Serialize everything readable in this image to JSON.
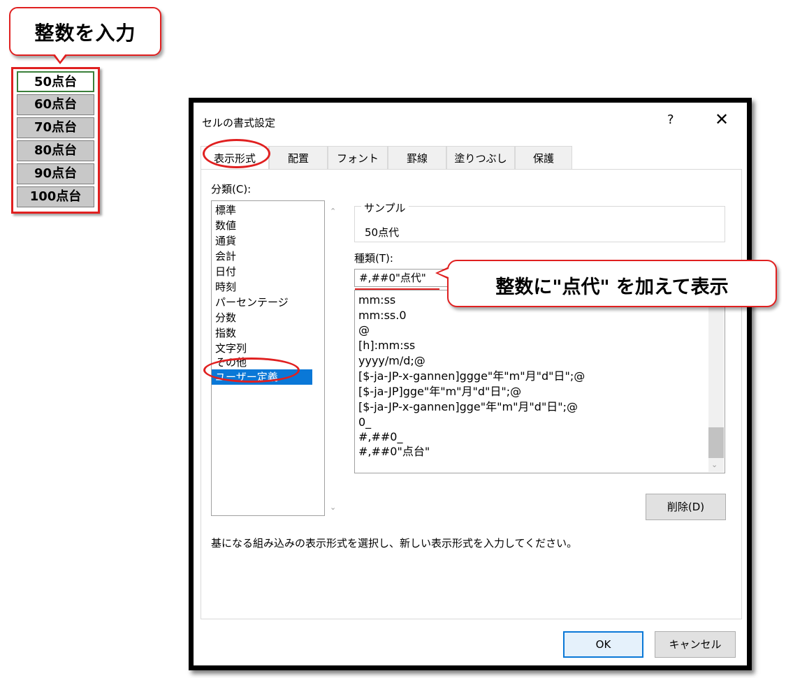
{
  "callouts": {
    "top": "整数を入力",
    "main": "整数に\"点代\" を加えて表示"
  },
  "cells": [
    "50点台",
    "60点台",
    "70点台",
    "80点台",
    "90点台",
    "100点台"
  ],
  "dialog": {
    "title": "セルの書式設定",
    "help": "?",
    "close": "✕",
    "tabs": [
      "表示形式",
      "配置",
      "フォント",
      "罫線",
      "塗りつぶし",
      "保護"
    ],
    "category_label": "分類(C):",
    "categories": [
      "標準",
      "数値",
      "通貨",
      "会計",
      "日付",
      "時刻",
      "パーセンテージ",
      "分数",
      "指数",
      "文字列",
      "その他",
      "ユーザー定義"
    ],
    "selected_category": "ユーザー定義",
    "sample_label": "サンプル",
    "sample_value": "50点代",
    "type_label": "種類(T):",
    "type_value": "#,##0\"点代\"",
    "type_list": [
      "mm:ss",
      "mm:ss.0",
      "@",
      "[h]:mm:ss",
      "yyyy/m/d;@",
      "[$-ja-JP-x-gannen]ggge\"年\"m\"月\"d\"日\";@",
      "[$-ja-JP]gge\"年\"m\"月\"d\"日\";@",
      "[$-ja-JP-x-gannen]gge\"年\"m\"月\"d\"日\";@",
      "0_",
      "#,##0_",
      "#,##0\"点台\""
    ],
    "delete_button": "削除(D)",
    "hint": "基になる組み込みの表示形式を選択し、新しい表示形式を入力してください。",
    "ok": "OK",
    "cancel": "キャンセル"
  },
  "colors": {
    "accent_red": "#e02020",
    "selection_blue": "#0a78d7"
  }
}
